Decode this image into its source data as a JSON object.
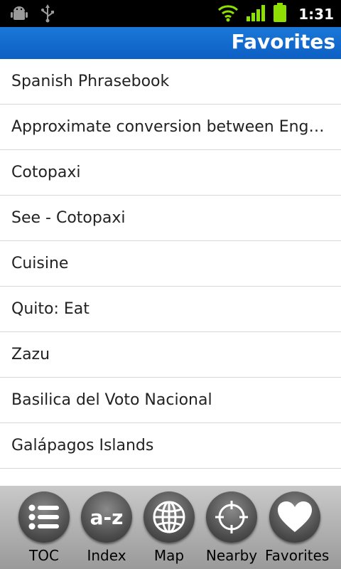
{
  "status": {
    "time": "1:31"
  },
  "header": {
    "title": "Favorites"
  },
  "items": [
    {
      "label": "Spanish Phrasebook"
    },
    {
      "label": "Approximate conversion between English"
    },
    {
      "label": "Cotopaxi"
    },
    {
      "label": "See - Cotopaxi"
    },
    {
      "label": "Cuisine"
    },
    {
      "label": "Quito: Eat"
    },
    {
      "label": "Zazu"
    },
    {
      "label": "Basilica del Voto Nacional"
    },
    {
      "label": "Galápagos Islands"
    }
  ],
  "tabs": [
    {
      "label": "TOC",
      "icon": "list-icon"
    },
    {
      "label": "Index",
      "icon": "az-icon"
    },
    {
      "label": "Map",
      "icon": "globe-icon"
    },
    {
      "label": "Nearby",
      "icon": "crosshair-icon"
    },
    {
      "label": "Favorites",
      "icon": "heart-icon"
    }
  ],
  "colors": {
    "header": "#0d5fc4",
    "statusbar": "#000000",
    "tabbar": "#b0b0b0"
  }
}
